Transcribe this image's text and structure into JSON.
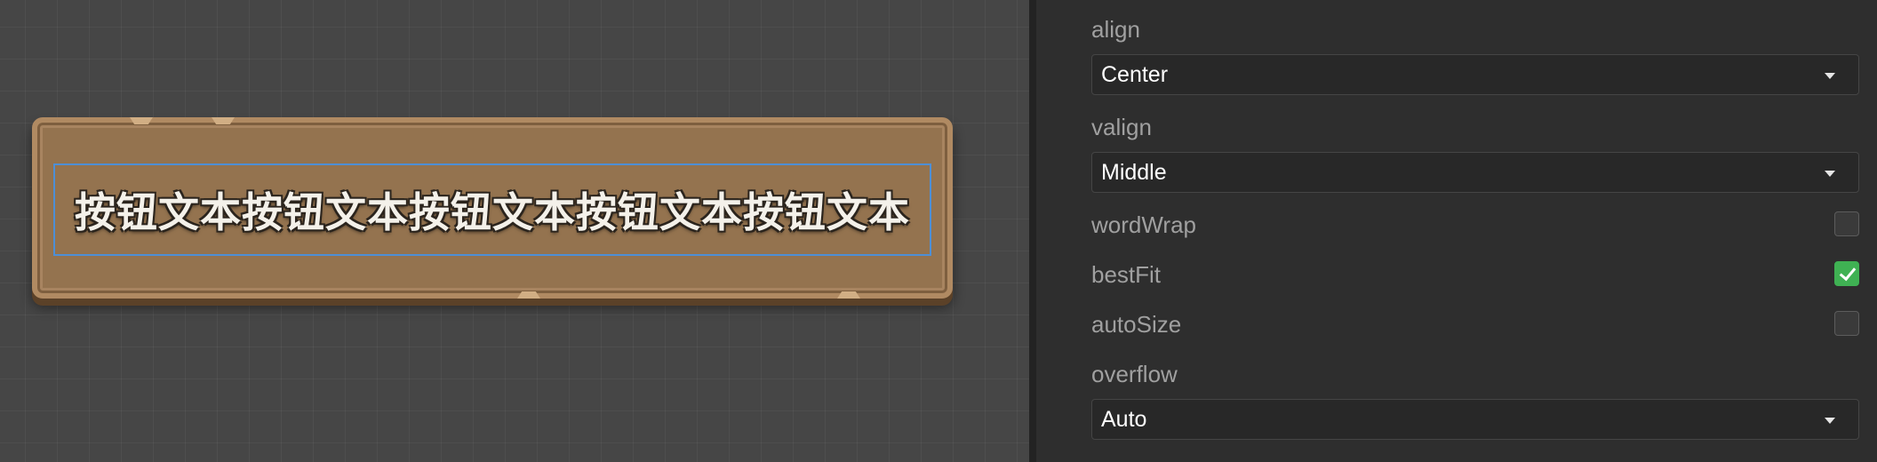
{
  "scene": {
    "button_label": "按钮文本按钮文本按钮文本按钮文本按钮文本"
  },
  "inspector": {
    "align": {
      "label": "align",
      "value": "Center"
    },
    "valign": {
      "label": "valign",
      "value": "Middle"
    },
    "wordWrap": {
      "label": "wordWrap",
      "checked": false
    },
    "bestFit": {
      "label": "bestFit",
      "checked": true
    },
    "autoSize": {
      "label": "autoSize",
      "checked": false
    },
    "overflow": {
      "label": "overflow",
      "value": "Auto"
    }
  },
  "icons": {
    "dropdown": "chevron-down-icon",
    "checked": "checkmark-icon"
  },
  "colors": {
    "checkbox_checked": "#3fb153",
    "selection_outline": "#4d8fd6",
    "wood": "#94734f"
  }
}
